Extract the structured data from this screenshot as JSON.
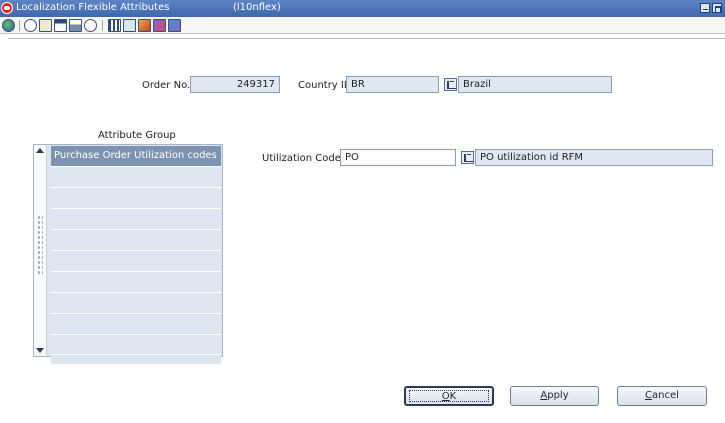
{
  "window": {
    "title": "Localization Flexible Attributes",
    "form_id": "(l10nflex)"
  },
  "toolbar": {
    "icons": [
      "globe-icon",
      "help-icon",
      "spell-icon",
      "calendar-icon",
      "print-icon",
      "info-icon",
      "grid-icon",
      "check-icon",
      "tools-icon",
      "export-icon",
      "import-icon"
    ]
  },
  "header": {
    "order_no_label": "Order No.",
    "order_no_value": "249317",
    "country_id_label": "Country ID",
    "country_id_value": "BR",
    "country_name": "Brazil"
  },
  "attribute_group": {
    "title": "Attribute Group",
    "rows": [
      "Purchase Order Utilization codes",
      "",
      "",
      "",
      "",
      "",
      "",
      "",
      "",
      "",
      ""
    ]
  },
  "utilization": {
    "label": "Utilization Code",
    "value": "PO",
    "description": "PO utilization id RFM"
  },
  "buttons": {
    "ok": {
      "pre": "",
      "key": "O",
      "post": "K"
    },
    "apply": {
      "pre": "",
      "key": "A",
      "post": "pply"
    },
    "cancel": {
      "pre": "",
      "key": "C",
      "post": "ancel"
    }
  },
  "colors": {
    "titlebar": "#4a72b6",
    "field_bg": "#dfe8f2",
    "selected_row": "#7d93b2"
  }
}
